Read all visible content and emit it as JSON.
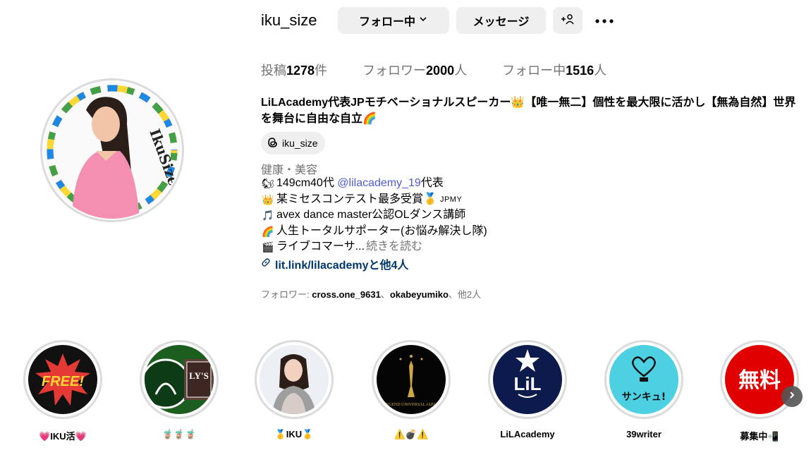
{
  "profile": {
    "username": "iku_size",
    "following_button": "フォロー中",
    "message_button": "メッセージ",
    "avatar_text": "IkuSize"
  },
  "stats": {
    "posts_label": "投稿",
    "posts_count": "1278",
    "posts_unit": "件",
    "followers_label": "フォロワー",
    "followers_count": "2000",
    "followers_unit": "人",
    "following_label": "フォロー中",
    "following_count": "1516",
    "following_unit": "人"
  },
  "bio": {
    "title": "LiLAcademy代表JPモチベーショナルスピーカー👑【唯一無二】個性を最大限に活かし【無為自然】世界を舞台に自由な自立🌈",
    "threads_handle": "iku_size",
    "category": "健康・美容",
    "line1_emoji": "🐿",
    "line1_pre": "149cm40代 ",
    "line1_mention": "@lilacademy_19",
    "line1_post": " 代表",
    "line2_emoji": "👑",
    "line2_text": "某ミセスコンテスト最多受賞🥇",
    "line2_tag": "JPMY",
    "line3_emoji": "🎵",
    "line3_text": "avex dance master公認OLダンス講師",
    "line4_emoji": "🌈",
    "line4_text": "人生トータルサポーター(お悩み解決し隊)",
    "line5_emoji": "🎬",
    "line5_text": "ライブコマーサ...",
    "read_more": "続きを読む",
    "link_text": "lit.link/lilacademyと他4人"
  },
  "followed_by": {
    "prefix": "フォロワー: ",
    "user1": "cross.one_9631",
    "sep": "、",
    "user2": "okabeyumiko",
    "suffix": "、他2人"
  },
  "highlights": [
    {
      "label": "💗IKU活💗",
      "badge": "FREE!"
    },
    {
      "label": "🧋🧋🧋",
      "badge": "LY'S"
    },
    {
      "label": "🥇IKU🥇",
      "badge": ""
    },
    {
      "label": "⚠️💣⚠️",
      "badge": "LEGEND UNIVERSAL JAPAN"
    },
    {
      "label": "LiLAcademy",
      "badge": "LiL"
    },
    {
      "label": "39writer",
      "badge": "サンキュ!"
    },
    {
      "label": "募集中📲",
      "badge": "無料"
    }
  ],
  "colors": {
    "button_bg": "#efefef",
    "secondary_text": "#737373",
    "link": "#00376b",
    "mention": "#4f5bd5"
  }
}
